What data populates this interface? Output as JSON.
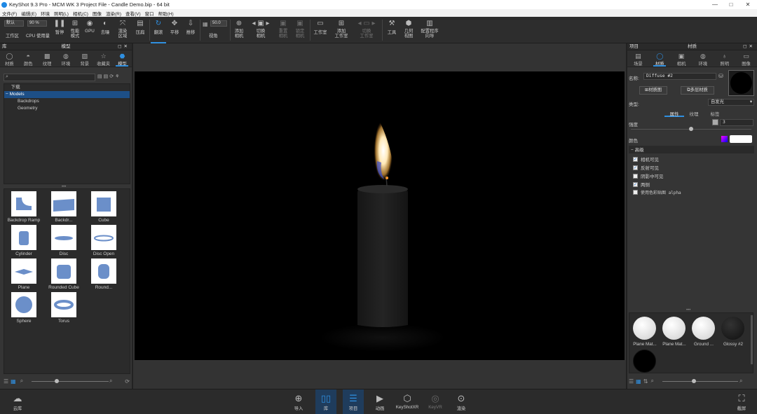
{
  "window": {
    "title": "KeyShot 9.3 Pro  - MCM WK 3 Project File - Candle Demo.bip  - 64 bit",
    "controls": [
      "—",
      "□",
      "✕"
    ]
  },
  "menu": [
    "文件(F)",
    "编辑(E)",
    "环境",
    "照明(L)",
    "相机(C)",
    "图像",
    "渲染(R)",
    "查看(V)",
    "窗口",
    "帮助(H)"
  ],
  "toolbar": {
    "workspace_value": "默认",
    "workspace_label": "工作区",
    "cpu_value": "90 %",
    "cpu_label": "CPU 使用量",
    "pause": "暂停",
    "performance_mode": "性能\n模式",
    "gpu": "GPU",
    "denoise": "去噪",
    "region_render": "渲染\n区域",
    "flatten": "压扁",
    "tumble": "翻滚",
    "pan": "平移",
    "dolly": "推移",
    "fov_value": "50.0",
    "fov_label": "视角",
    "add_camera": "添加\n相机",
    "switch_camera": "切换\n相机",
    "reset_camera": "重置\n相机",
    "lock_camera": "锁定\n相机",
    "studio": "工作室",
    "add_studio": "添加\n工作室",
    "switch_studio": "切换\n工作室",
    "tools": "工具",
    "geometry_view": "几何\n视图",
    "configurator": "配置程序\n向导"
  },
  "library": {
    "title": "库",
    "panel_title": "模型",
    "tabs": [
      {
        "label": "材质",
        "icon": "material-icon"
      },
      {
        "label": "颜色",
        "icon": "color-icon"
      },
      {
        "label": "纹理",
        "icon": "texture-icon"
      },
      {
        "label": "环境",
        "icon": "environment-icon"
      },
      {
        "label": "背景",
        "icon": "background-icon"
      },
      {
        "label": "收藏夹",
        "icon": "favorites-icon"
      },
      {
        "label": "模型",
        "icon": "model-icon"
      }
    ],
    "tree": [
      "下载",
      "Models",
      "Backdrops",
      "Geometry"
    ],
    "thumbnails": [
      "Backdrop Ramp",
      "Backdr...",
      "Cube",
      "Cylinder",
      "Disc",
      "Disc Open",
      "Plane",
      "Rounded Cube",
      "Round...",
      "Sphere",
      "Torus"
    ]
  },
  "project": {
    "title": "项目",
    "panel_title": "材质",
    "tabs": [
      {
        "label": "场景",
        "icon": "scene-icon"
      },
      {
        "label": "材质",
        "icon": "material-icon"
      },
      {
        "label": "相机",
        "icon": "camera-icon"
      },
      {
        "label": "环境",
        "icon": "environment-icon"
      },
      {
        "label": "照明",
        "icon": "lighting-icon"
      },
      {
        "label": "图像",
        "icon": "image-icon"
      }
    ],
    "name_label": "名称:",
    "name_value": "Diffuse #2",
    "material_graph": "材质图",
    "multi_material": "多层材质",
    "type_label": "类型:",
    "type_value": "自发光",
    "subtabs": [
      "属性",
      "纹理",
      "标签"
    ],
    "intensity_label": "强度",
    "intensity_value": "3",
    "color_label": "颜色",
    "advanced_label": "高级",
    "options": [
      {
        "label": "相机可见",
        "checked": true
      },
      {
        "label": "反射可见",
        "checked": true
      },
      {
        "label": "阴影中可见",
        "checked": false
      },
      {
        "label": "两侧",
        "checked": true
      },
      {
        "label": "使用色彩贴图 alpha",
        "checked": false
      }
    ],
    "materials": [
      "Plane Mat...",
      "Plane Mat...",
      "Ground ...",
      "Glossy #2",
      ""
    ]
  },
  "bottom": {
    "cloud": "云库",
    "buttons": [
      "导入",
      "库",
      "项目",
      "动画",
      "KeyShotXR",
      "KeyVR",
      "渲染"
    ],
    "screenshot": "截屏"
  },
  "colors": {
    "accent": "#2f8fe0",
    "selection": "#1d4f86",
    "emissive_color": "#ffffff",
    "swatch": "#cc00cc"
  }
}
